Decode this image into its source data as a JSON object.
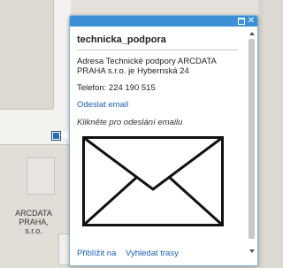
{
  "map": {
    "label_lines": [
      "ARCDATA",
      "PRAHA,",
      "s.r.o."
    ]
  },
  "popup": {
    "title": "technicka_podpora",
    "address_lines": [
      "Adresa Technické podpory ARCDATA",
      "PRAHA s.r.o. je Hybernská 24"
    ],
    "phone": "Telefon: 224 190 515",
    "email_link": "Odeslat email",
    "hint": "Klikněte pro odeslání emailu",
    "actions": {
      "zoom": "Přiblížit na",
      "route": "Vyhledat trasy"
    },
    "controls": {
      "maximize_icon": "maximize-icon",
      "close_icon": "close-icon",
      "close_glyph": "✕"
    },
    "colors": {
      "titlebar": "#3d8fd6",
      "link": "#1a5fb4",
      "marker": "#2a6fb3"
    }
  }
}
